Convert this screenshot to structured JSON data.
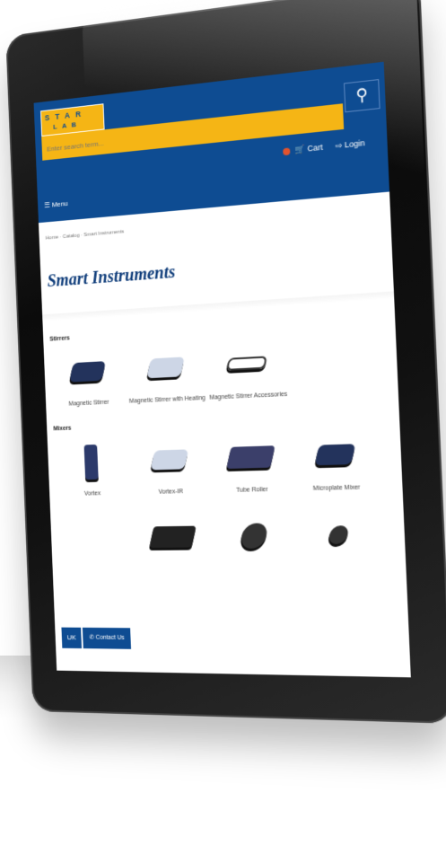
{
  "header": {
    "logo_top": "STAR",
    "logo_bottom": "LAB",
    "search_placeholder": "Enter search term...",
    "search_icon": "search-icon",
    "cart_label": "Cart",
    "login_label": "Login",
    "menu_label": "Menu"
  },
  "breadcrumb": "Home · Catalog · Smart Instruments",
  "page_title": "Smart Instruments",
  "sections": [
    {
      "heading": "Stirrers",
      "items": [
        "Magnetic Stirrer",
        "Magnetic Stirrer with Heating",
        "Magnetic Stirrer Accessories"
      ]
    },
    {
      "heading": "Mixers",
      "items": [
        "Vortex",
        "Vortex-IR",
        "Tube Roller",
        "Microplate Mixer"
      ]
    }
  ],
  "bottom": {
    "flag_label": "UK",
    "contact_label": "Contact Us"
  }
}
